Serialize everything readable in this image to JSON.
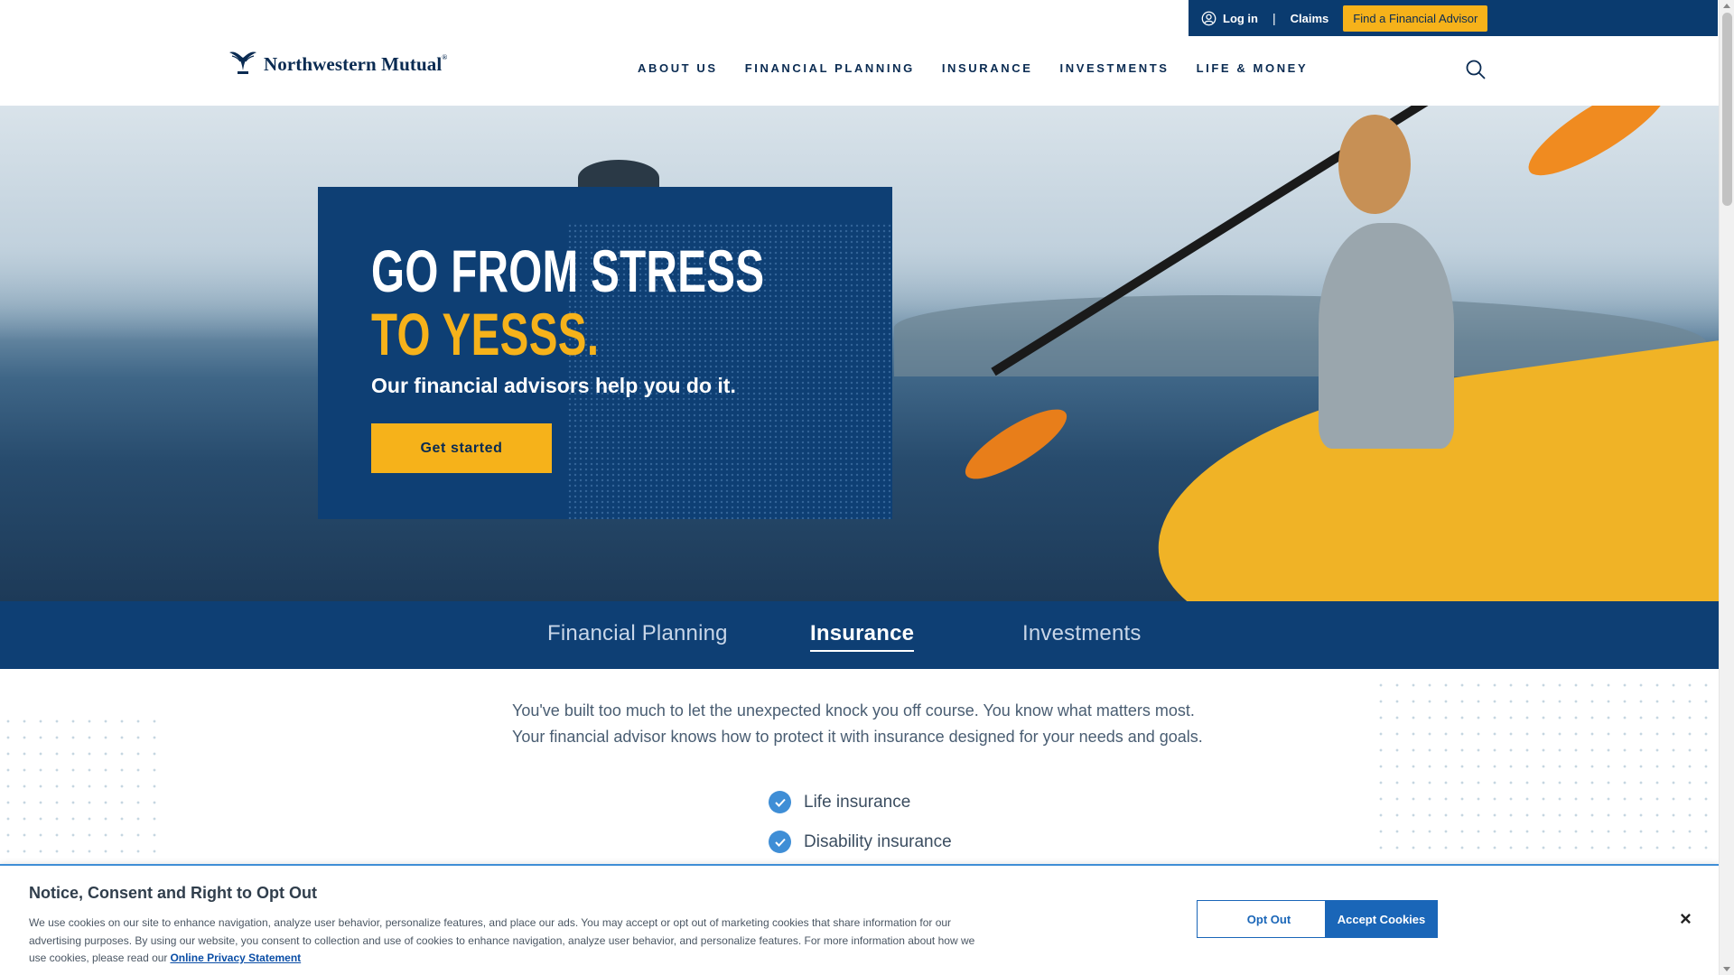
{
  "utility": {
    "login_label": "Log in",
    "separator": "|",
    "claims_label": "Claims",
    "advisor_label": "Find a Financial Advisor"
  },
  "header": {
    "logo_text": "Northwestern Mutual",
    "logo_mark": "®",
    "nav": [
      "ABOUT US",
      "FINANCIAL PLANNING",
      "INSURANCE",
      "INVESTMENTS",
      "LIFE & MONEY"
    ]
  },
  "hero": {
    "title_line1": "GO FROM STRESS",
    "title_line2": "TO YESSS.",
    "subtitle": "Our financial advisors help you do it.",
    "cta_label": "Get started"
  },
  "tabs": {
    "items": [
      "Financial Planning",
      "Insurance",
      "Investments"
    ],
    "active": "Insurance"
  },
  "content": {
    "intro": "You've built too much to let the unexpected knock you off course. You know what matters most. Your financial advisor knows how to protect it with insurance designed for your needs and goals.",
    "checklist": [
      "Life insurance",
      "Disability insurance"
    ]
  },
  "cookie": {
    "title": "Notice, Consent and Right to Opt Out",
    "text": "We use cookies on our site to enhance navigation, analyze user behavior, personalize features, and place our ads. You may accept or opt out of marketing cookies that share information for our advertising purposes. By using our website, you consent to collection and use of cookies to enhance navigation, analyze user behavior, and personalize features. For more information about how we use cookies, please read our",
    "link_label": "Online Privacy Statement",
    "optout_label": "Opt Out",
    "accept_label": "Accept Cookies",
    "close_label": "×"
  },
  "colors": {
    "navy": "#0e3f74",
    "gold": "#f6b21a",
    "link_blue": "#1a66b8"
  }
}
